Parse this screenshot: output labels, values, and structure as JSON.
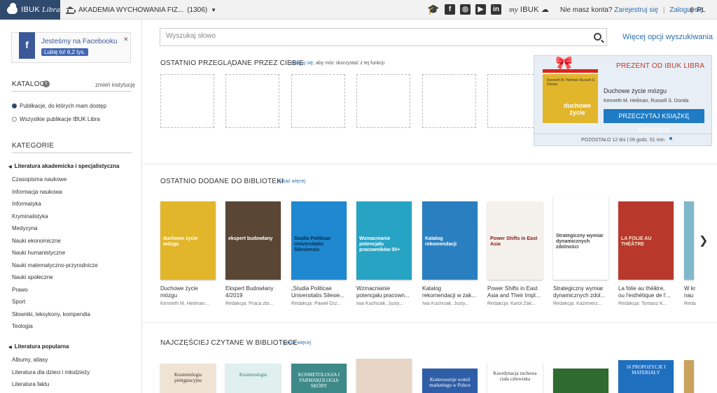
{
  "topbar": {
    "brand": "IBUK",
    "brand_script": "Libra",
    "institution": "AKADEMIA WYCHOWANIA FIZ...",
    "institution_count": "(1306)",
    "myibuk_prefix": "my",
    "myibuk": "IBUK",
    "no_account": "Nie masz konta?",
    "register": "Zarejestruj się",
    "login": "Zaloguj się",
    "lang": "PL"
  },
  "sidebar": {
    "fb_title": "Jesteśmy na Facebooku",
    "fb_like": "Lubię to! 6,2 tys.",
    "catalog_head": "KATALOG",
    "change_inst": "zmień instytucję",
    "radio_1": "Publikacje, do których mam dostęp",
    "radio_2": "Wszystkie publikacje IBUK Libra",
    "categories_head": "KATEGORIE",
    "group_1": "Literatura akademicka i specjalistyczna",
    "group_1_items": [
      "Czasopisma naukowe",
      "Informacja naukowa",
      "Informatyka",
      "Kryminalistyka",
      "Medycyna",
      "Nauki ekonomiczne",
      "Nauki humanistyczne",
      "Nauki matematyczno-przyrodnicze",
      "Nauki społeczne",
      "Prawo",
      "Sport",
      "Słowniki, leksykony, kompendia",
      "Teologia"
    ],
    "group_2": "Literatura popularna",
    "group_2_items": [
      "Albumy, atlasy",
      "Literatura dla dzieci i młodzieży",
      "Literatura faktu"
    ]
  },
  "search": {
    "placeholder": "Wyszukaj słowo",
    "more": "Więcej opcji wyszukiwania"
  },
  "recent": {
    "title": "OSTATNIO PRZEGLĄDANE PRZEZ CIEBIE",
    "login_link": "zaloguj się",
    "note": ", aby móc skorzystać z tej funkcji"
  },
  "gift": {
    "title": "PREZENT OD IBUK LIBRA",
    "book_title": "Duchowe życie mózgu",
    "authors": "Kenneth M. Heilman, Russell S. Donda",
    "button": "PRZECZYTAJ KSIĄŻKĘ MIESIĄCA",
    "remaining": "POZOSTAŁO 12 dni | 09 godz. 51 min",
    "cover_authors": "Kenneth M. Heilman Russell S. Donda",
    "cover_title": "duchowe życie"
  },
  "added": {
    "title": "OSTATNIO DODANE DO BIBLIOTEKI",
    "more": "pokaż więcej",
    "books": [
      {
        "t1": "Duchowe życie",
        "t2": "mózgu",
        "a": "Kenneth M. Heilman...",
        "cover": "#e2b62b",
        "ctext": "duchowe życie mózgu",
        "cc": "#ffffff"
      },
      {
        "t1": "Ekspert Budowlany",
        "t2": "4/2019",
        "a": "Redakcja: Praca zbi...",
        "cover": "#5a4634",
        "ctext": "ekspert budowlany",
        "cc": "#ffffff"
      },
      {
        "t1": "„Studia Politicae",
        "t2": "Universitatis Silesie...",
        "a": "Redakcja: Paweł Grz...",
        "cover": "#1e88d0",
        "ctext": "Studia Politicae Universitatis Silesiensis",
        "cc": "#0b2a4a"
      },
      {
        "t1": "Wzmacnianie",
        "t2": "potencjału pracown...",
        "a": "Iwa Kuchciak, Justy...",
        "cover": "#27a3c4",
        "ctext": "Wzmacnianie potencjału pracowników 50+",
        "cc": "#ffffff"
      },
      {
        "t1": "Katalog",
        "t2": "rekomendacji w zak...",
        "a": "Iwa Kuchciak, Justy...",
        "cover": "#2a7fc0",
        "ctext": "Katalog rekomendacji",
        "cc": "#ffffff"
      },
      {
        "t1": "Power Shifts in East",
        "t2": "Asia and Their Impl...",
        "a": "Redakcja: Karol Żak...",
        "cover": "#f4f1ec",
        "ctext": "Power Shifts in East Asia",
        "cc": "#8b1a1a"
      },
      {
        "t1": "Strategiczny wymiar",
        "t2": "dynamicznych zdol...",
        "a": "Redakcja: Kazimierz...",
        "cover": "#ffffff",
        "ctext": "Strategiczny wymiar dynamicznych zdolności",
        "cc": "#444444"
      },
      {
        "t1": "La folie au théâtre,",
        "t2": "ou l'esthétique de l'...",
        "a": "Redakcja: Tomasz K...",
        "cover": "#b8392c",
        "ctext": "LA FOLIE AU THÉÂTRE",
        "cc": "#f4e8cf"
      },
      {
        "t1": "W kr",
        "t2": "nau",
        "a": "Reda",
        "cover": "#7fb8c9",
        "ctext": "",
        "cc": "#ffffff"
      }
    ]
  },
  "popular": {
    "title": "NAJCZĘŚCIEJ CZYTANE W BIBLIOTECE",
    "more": "pokaż więcej",
    "books": [
      {
        "cover": "#f1e3d3",
        "ctext": "Kosmetologia pielęgnacyjna",
        "cc": "#333333"
      },
      {
        "cover": "#dff0ee",
        "ctext": "Kosmetologia",
        "cc": "#2f7a73"
      },
      {
        "cover": "#3e8a89",
        "ctext": "KOSMETOLOGIA I FARMAKOLOGIA SKÓRY",
        "cc": "#ffffff"
      },
      {
        "cover": "#e7d6c6",
        "ctext": "",
        "cc": "#333333"
      },
      {
        "cover": "#2f5ea8",
        "ctext": "Kontrowersje wokół marketingu w Polsce",
        "cc": "#ffffff"
      },
      {
        "cover": "#ffffff",
        "ctext": "Koordynacja ruchowa ciała człowieka",
        "cc": "#333333"
      },
      {
        "cover": "#2f6a2f",
        "ctext": "",
        "cc": "#ffffff"
      },
      {
        "cover": "#1f6fbf",
        "ctext": "16 PROPOZYCJE I MATERIAŁY",
        "cc": "#ffffff"
      },
      {
        "cover": "#c9a25c",
        "ctext": "",
        "cc": "#ffffff"
      }
    ]
  }
}
